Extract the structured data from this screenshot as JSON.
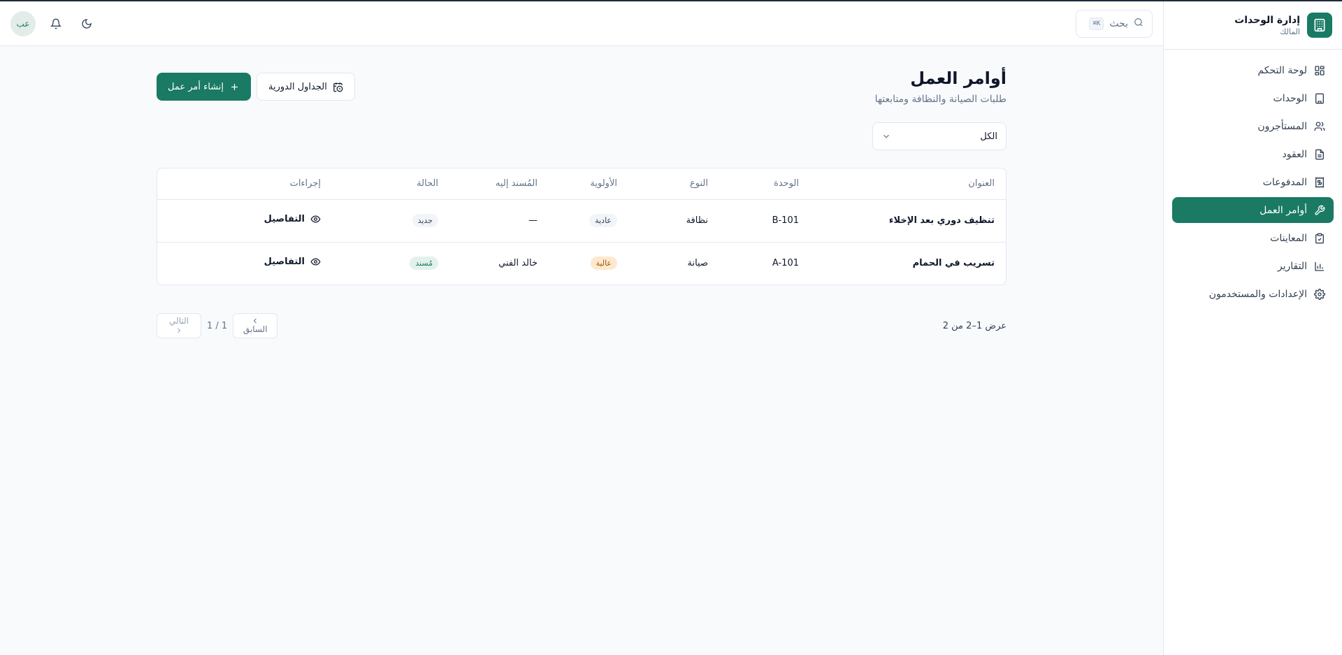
{
  "brand": {
    "title": "إدارة الوحدات",
    "subtitle": "المالك"
  },
  "sidebar": {
    "items": [
      {
        "label": "لوحة التحكم",
        "icon": "dashboard-icon",
        "active": false
      },
      {
        "label": "الوحدات",
        "icon": "building-icon",
        "active": false
      },
      {
        "label": "المستأجرون",
        "icon": "users-icon",
        "active": false
      },
      {
        "label": "العقود",
        "icon": "document-icon",
        "active": false
      },
      {
        "label": "المدفوعات",
        "icon": "receipt-icon",
        "active": false
      },
      {
        "label": "أوامر العمل",
        "icon": "wrench-icon",
        "active": true
      },
      {
        "label": "المعاينات",
        "icon": "clipboard-check-icon",
        "active": false
      },
      {
        "label": "التقارير",
        "icon": "bar-chart-icon",
        "active": false
      },
      {
        "label": "الإعدادات والمستخدمون",
        "icon": "gear-icon",
        "active": false
      }
    ]
  },
  "topbar": {
    "search_label": "بحث",
    "search_shortcut": "K⌘",
    "avatar_initials": "عب"
  },
  "page": {
    "title": "أوامر العمل",
    "subtitle": "طلبات الصيانة والنظافة ومتابعتها",
    "schedules_button": "الجداول الدورية",
    "create_button": "إنشاء أمر عمل"
  },
  "filter": {
    "value": "الكل"
  },
  "table": {
    "columns": {
      "title": "العنوان",
      "unit": "الوحدة",
      "type": "النوع",
      "priority": "الأولوية",
      "assignee": "المُسند إليه",
      "status": "الحالة",
      "actions": "إجراءات"
    },
    "rows": [
      {
        "title": "تنظيف دوري بعد الإخلاء",
        "unit": "B-101",
        "type": "نظافة",
        "priority": "عادية",
        "assignee": "—",
        "status": "جديد",
        "action": "التفاصيل"
      },
      {
        "title": "تسريب في الحمام",
        "unit": "A-101",
        "type": "صيانة",
        "priority": "عالية",
        "assignee": "خالد الفني",
        "status": "مُسند",
        "action": "التفاصيل"
      }
    ]
  },
  "pagination": {
    "summary": "عرض 1–2 من 2",
    "prev_label": "السابق",
    "next_label": "التالي",
    "page_indicator": "1 / 1"
  },
  "colors": {
    "primary": "#1a7a63",
    "high_priority_bg": "#fde9cf",
    "assigned_bg": "#e3f1ec"
  }
}
